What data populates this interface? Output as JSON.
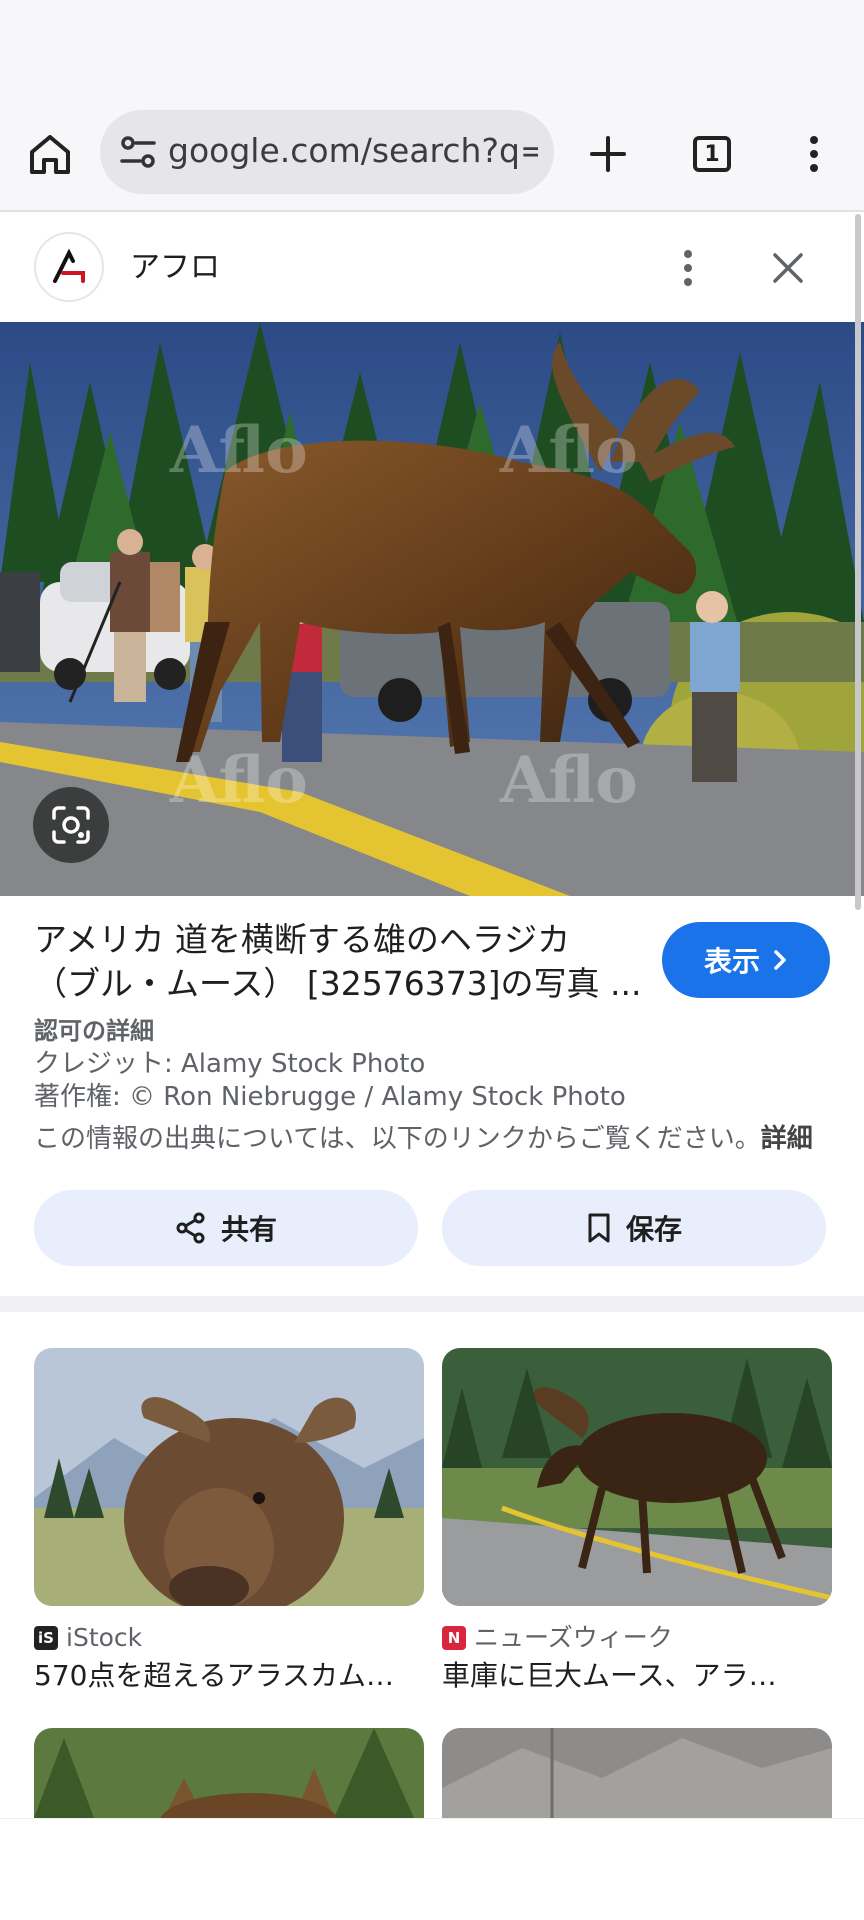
{
  "browser": {
    "url_text": "google.com/search?q=ア",
    "tab_count": "1"
  },
  "result": {
    "site_name": "アフロ",
    "title_line1": "アメリカ 道を横断する雄のヘラジカ",
    "title_line2": "（ブル・ムース） [32576373]の写真 ...",
    "visit_label": "表示",
    "license_heading": "認可の詳細",
    "credit": "クレジット: Alamy Stock Photo",
    "copyright": "著作権: © Ron Niebrugge / Alamy Stock Photo",
    "source_note": "この情報の出典については、以下のリンクからご覧ください。",
    "source_more": "詳細",
    "share_label": "共有",
    "save_label": "保存",
    "watermark": "Aflo"
  },
  "related": [
    {
      "source": "iStock",
      "caption": "570点を超えるアラスカム…"
    },
    {
      "source": "ニューズウィーク",
      "caption": "車庫に巨大ムース、アラ…"
    }
  ],
  "colors": {
    "accent": "#1a73e8",
    "action_bg": "#e8eefb",
    "istock": "#222222",
    "newsweek": "#d7263d"
  }
}
